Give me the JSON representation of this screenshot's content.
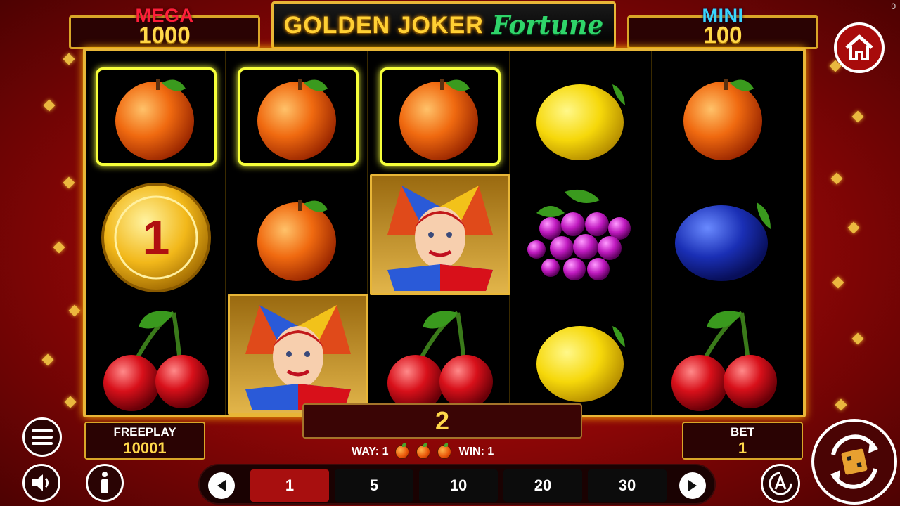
{
  "jackpots": {
    "mega": {
      "label": "MEGA",
      "value": "1000"
    },
    "mini": {
      "label": "MINI",
      "value": "100"
    }
  },
  "title": {
    "main": "GOLDEN JOKER",
    "sub": "Fortune"
  },
  "corner": "0",
  "reels": [
    [
      "orange",
      "gold-coin",
      "cherry"
    ],
    [
      "orange",
      "orange",
      "joker"
    ],
    [
      "orange",
      "joker",
      "cherry"
    ],
    [
      "lemon",
      "grape",
      "lemon"
    ],
    [
      "orange",
      "plum",
      "cherry"
    ]
  ],
  "coin_value": "1",
  "freeplay": {
    "label": "FREEPLAY",
    "value": "10001"
  },
  "bet": {
    "label": "BET",
    "value": "1"
  },
  "win_amount": "2",
  "way_line": {
    "way": "WAY: 1",
    "win": "WIN: 1",
    "symbols": [
      "orange",
      "orange",
      "orange"
    ]
  },
  "bet_options": [
    "1",
    "5",
    "10",
    "20",
    "30"
  ],
  "selected_bet_index": 0,
  "icons": {
    "home": "home-icon",
    "menu": "hamburger-menu-icon",
    "sound": "speaker-icon",
    "info": "info-icon",
    "prev": "arrow-left-icon",
    "next": "arrow-right-icon",
    "auto": "autoplay-icon",
    "spin": "spin-icon"
  },
  "colors": {
    "gold": "#e8b637",
    "red": "#a80f0f",
    "highlight": "#f6ff3a"
  }
}
